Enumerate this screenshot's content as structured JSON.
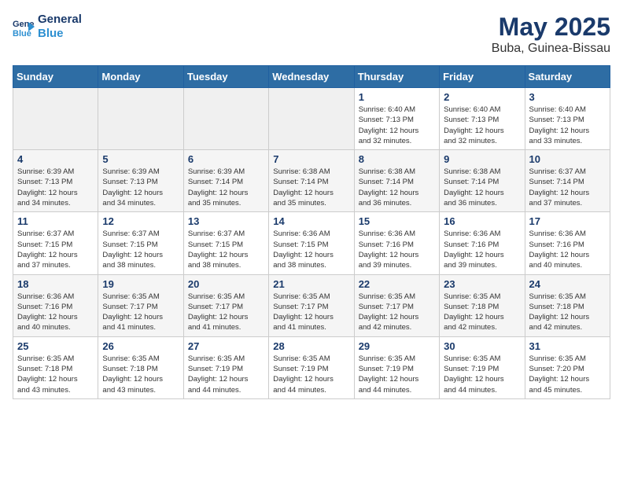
{
  "logo": {
    "line1": "General",
    "line2": "Blue"
  },
  "title": "May 2025",
  "location": "Buba, Guinea-Bissau",
  "days_of_week": [
    "Sunday",
    "Monday",
    "Tuesday",
    "Wednesday",
    "Thursday",
    "Friday",
    "Saturday"
  ],
  "weeks": [
    [
      {
        "day": "",
        "info": ""
      },
      {
        "day": "",
        "info": ""
      },
      {
        "day": "",
        "info": ""
      },
      {
        "day": "",
        "info": ""
      },
      {
        "day": "1",
        "info": "Sunrise: 6:40 AM\nSunset: 7:13 PM\nDaylight: 12 hours\nand 32 minutes."
      },
      {
        "day": "2",
        "info": "Sunrise: 6:40 AM\nSunset: 7:13 PM\nDaylight: 12 hours\nand 32 minutes."
      },
      {
        "day": "3",
        "info": "Sunrise: 6:40 AM\nSunset: 7:13 PM\nDaylight: 12 hours\nand 33 minutes."
      }
    ],
    [
      {
        "day": "4",
        "info": "Sunrise: 6:39 AM\nSunset: 7:13 PM\nDaylight: 12 hours\nand 34 minutes."
      },
      {
        "day": "5",
        "info": "Sunrise: 6:39 AM\nSunset: 7:13 PM\nDaylight: 12 hours\nand 34 minutes."
      },
      {
        "day": "6",
        "info": "Sunrise: 6:39 AM\nSunset: 7:14 PM\nDaylight: 12 hours\nand 35 minutes."
      },
      {
        "day": "7",
        "info": "Sunrise: 6:38 AM\nSunset: 7:14 PM\nDaylight: 12 hours\nand 35 minutes."
      },
      {
        "day": "8",
        "info": "Sunrise: 6:38 AM\nSunset: 7:14 PM\nDaylight: 12 hours\nand 36 minutes."
      },
      {
        "day": "9",
        "info": "Sunrise: 6:38 AM\nSunset: 7:14 PM\nDaylight: 12 hours\nand 36 minutes."
      },
      {
        "day": "10",
        "info": "Sunrise: 6:37 AM\nSunset: 7:14 PM\nDaylight: 12 hours\nand 37 minutes."
      }
    ],
    [
      {
        "day": "11",
        "info": "Sunrise: 6:37 AM\nSunset: 7:15 PM\nDaylight: 12 hours\nand 37 minutes."
      },
      {
        "day": "12",
        "info": "Sunrise: 6:37 AM\nSunset: 7:15 PM\nDaylight: 12 hours\nand 38 minutes."
      },
      {
        "day": "13",
        "info": "Sunrise: 6:37 AM\nSunset: 7:15 PM\nDaylight: 12 hours\nand 38 minutes."
      },
      {
        "day": "14",
        "info": "Sunrise: 6:36 AM\nSunset: 7:15 PM\nDaylight: 12 hours\nand 38 minutes."
      },
      {
        "day": "15",
        "info": "Sunrise: 6:36 AM\nSunset: 7:16 PM\nDaylight: 12 hours\nand 39 minutes."
      },
      {
        "day": "16",
        "info": "Sunrise: 6:36 AM\nSunset: 7:16 PM\nDaylight: 12 hours\nand 39 minutes."
      },
      {
        "day": "17",
        "info": "Sunrise: 6:36 AM\nSunset: 7:16 PM\nDaylight: 12 hours\nand 40 minutes."
      }
    ],
    [
      {
        "day": "18",
        "info": "Sunrise: 6:36 AM\nSunset: 7:16 PM\nDaylight: 12 hours\nand 40 minutes."
      },
      {
        "day": "19",
        "info": "Sunrise: 6:35 AM\nSunset: 7:17 PM\nDaylight: 12 hours\nand 41 minutes."
      },
      {
        "day": "20",
        "info": "Sunrise: 6:35 AM\nSunset: 7:17 PM\nDaylight: 12 hours\nand 41 minutes."
      },
      {
        "day": "21",
        "info": "Sunrise: 6:35 AM\nSunset: 7:17 PM\nDaylight: 12 hours\nand 41 minutes."
      },
      {
        "day": "22",
        "info": "Sunrise: 6:35 AM\nSunset: 7:17 PM\nDaylight: 12 hours\nand 42 minutes."
      },
      {
        "day": "23",
        "info": "Sunrise: 6:35 AM\nSunset: 7:18 PM\nDaylight: 12 hours\nand 42 minutes."
      },
      {
        "day": "24",
        "info": "Sunrise: 6:35 AM\nSunset: 7:18 PM\nDaylight: 12 hours\nand 42 minutes."
      }
    ],
    [
      {
        "day": "25",
        "info": "Sunrise: 6:35 AM\nSunset: 7:18 PM\nDaylight: 12 hours\nand 43 minutes."
      },
      {
        "day": "26",
        "info": "Sunrise: 6:35 AM\nSunset: 7:18 PM\nDaylight: 12 hours\nand 43 minutes."
      },
      {
        "day": "27",
        "info": "Sunrise: 6:35 AM\nSunset: 7:19 PM\nDaylight: 12 hours\nand 44 minutes."
      },
      {
        "day": "28",
        "info": "Sunrise: 6:35 AM\nSunset: 7:19 PM\nDaylight: 12 hours\nand 44 minutes."
      },
      {
        "day": "29",
        "info": "Sunrise: 6:35 AM\nSunset: 7:19 PM\nDaylight: 12 hours\nand 44 minutes."
      },
      {
        "day": "30",
        "info": "Sunrise: 6:35 AM\nSunset: 7:19 PM\nDaylight: 12 hours\nand 44 minutes."
      },
      {
        "day": "31",
        "info": "Sunrise: 6:35 AM\nSunset: 7:20 PM\nDaylight: 12 hours\nand 45 minutes."
      }
    ]
  ]
}
